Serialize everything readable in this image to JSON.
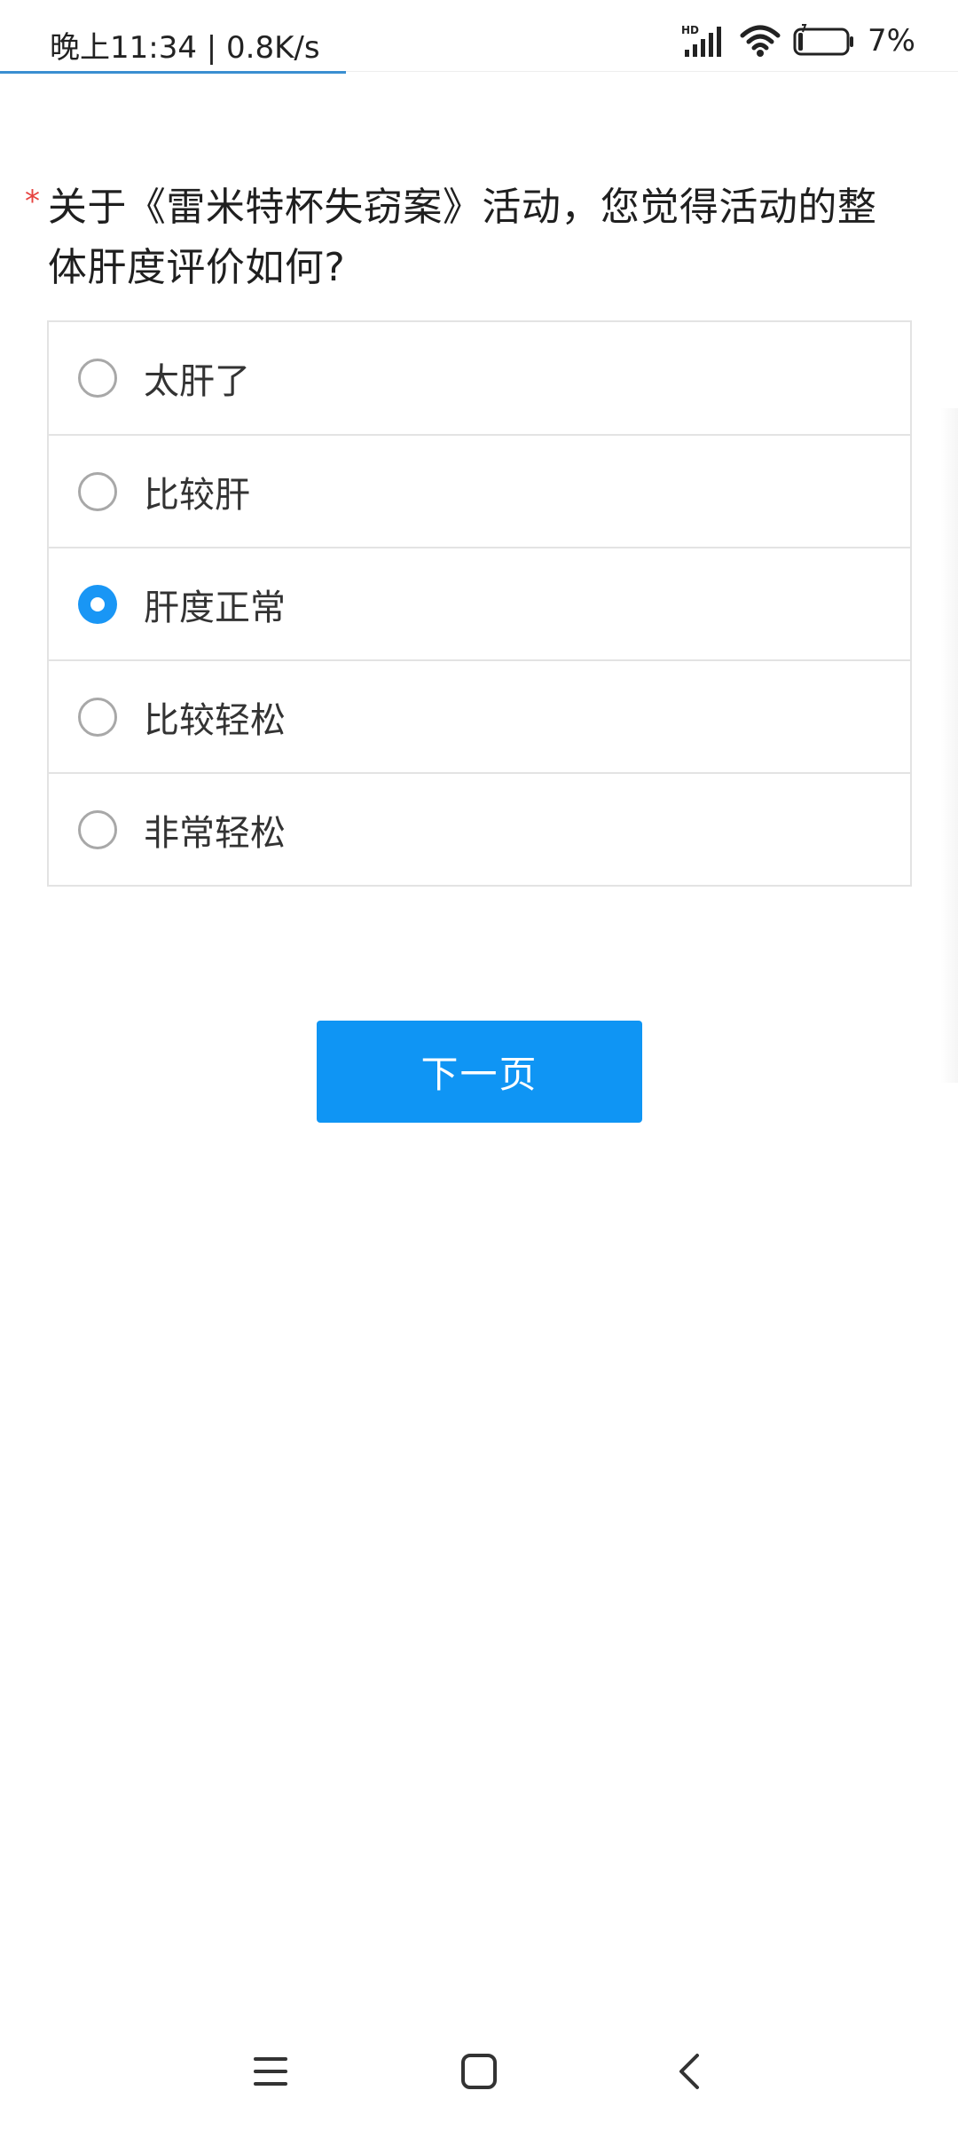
{
  "status_bar": {
    "time_speed": "晚上11:34 | 0.8K/s",
    "network_label": "HD",
    "battery_percent": "7%",
    "icons": [
      "hd-signal-icon",
      "wifi-icon",
      "battery-icon"
    ]
  },
  "question": {
    "required_mark": "*",
    "text": "关于《雷米特杯失窃案》活动，您觉得活动的整体肝度评价如何?"
  },
  "options": [
    {
      "label": "太肝了",
      "selected": false
    },
    {
      "label": "比较肝",
      "selected": false
    },
    {
      "label": "肝度正常",
      "selected": true
    },
    {
      "label": "比较轻松",
      "selected": false
    },
    {
      "label": "非常轻松",
      "selected": false
    }
  ],
  "next_button": {
    "label": "下一页"
  },
  "colors": {
    "accent": "#0f95f4",
    "required": "#e64340",
    "border": "#e3e3e3"
  },
  "nav_bar": {
    "icons": [
      "menu-icon",
      "home-icon",
      "back-icon"
    ]
  }
}
